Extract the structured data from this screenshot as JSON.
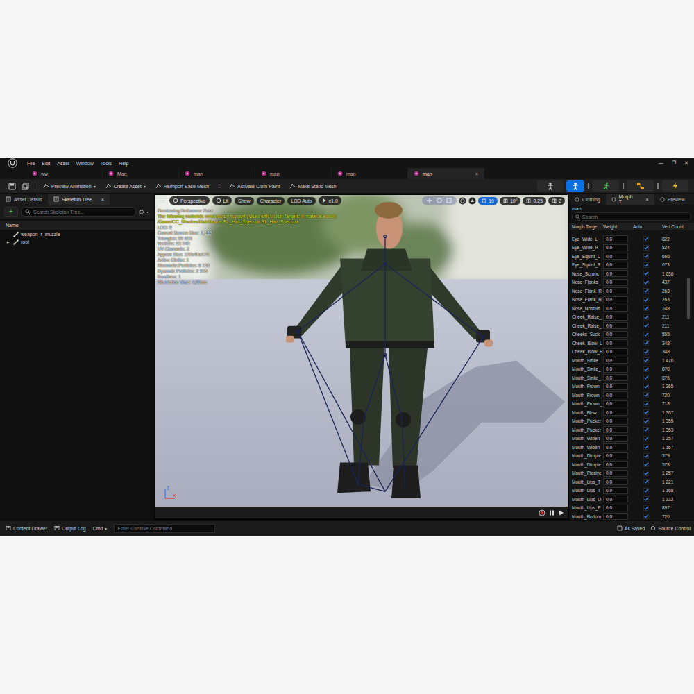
{
  "window": {
    "menu": [
      "File",
      "Edit",
      "Asset",
      "Window",
      "Tools",
      "Help"
    ],
    "controls": [
      "—",
      "❐",
      "✕"
    ]
  },
  "document_tabs": [
    {
      "label": "ww",
      "selected": false
    },
    {
      "label": "Man",
      "selected": false
    },
    {
      "label": "man",
      "selected": false
    },
    {
      "label": "man",
      "selected": false
    },
    {
      "label": "man",
      "selected": false
    },
    {
      "label": "man",
      "selected": true
    }
  ],
  "tab_close": "×",
  "toolbar": {
    "caret": "▾",
    "items": [
      {
        "label": "Preview Animation",
        "kind": "dropdown"
      },
      {
        "label": "Create Asset",
        "kind": "dropdown"
      },
      {
        "label": "Reimport Base Mesh",
        "kind": "button"
      },
      {
        "label": "⋮",
        "kind": "more"
      },
      {
        "label": "Activate Cloth Paint",
        "kind": "button"
      },
      {
        "label": "Make Static Mesh",
        "kind": "button"
      }
    ],
    "modes": [
      {
        "selected": false,
        "more": false
      },
      {
        "selected": true,
        "more": true
      },
      {
        "selected": false,
        "more": true
      },
      {
        "selected": false,
        "more": true
      },
      {
        "selected": false,
        "more": false
      }
    ]
  },
  "skeleton_panel": {
    "tabs": [
      {
        "label": "Asset Details",
        "selected": false,
        "closable": false
      },
      {
        "label": "Skeleton Tree",
        "selected": true,
        "closable": true
      }
    ],
    "add": "+",
    "search_placeholder": "Search Skeleton Tree...",
    "column": "Name",
    "expander": "▸",
    "bones": [
      {
        "label": "weapon_r_muzzle",
        "expandable": false
      },
      {
        "label": "root",
        "expandable": true
      }
    ]
  },
  "viewport": {
    "buttons": [
      {
        "label": "Perspective",
        "kind": "icon"
      },
      {
        "label": "Lit",
        "kind": "icon"
      },
      {
        "label": "Show",
        "kind": "text"
      },
      {
        "label": "Character",
        "kind": "text"
      },
      {
        "label": "LOD Auto",
        "kind": "text"
      },
      {
        "label": "x1.0",
        "kind": "play"
      }
    ],
    "snaps": [
      {
        "label": "10",
        "selected": true
      },
      {
        "label": "10°",
        "selected": false
      },
      {
        "label": "0,25",
        "selected": false
      },
      {
        "label": "2",
        "selected": false
      }
    ],
    "info": [
      {
        "text": "Previewing Reference Pose",
        "kind": "heading"
      },
      {
        "text": "The following materials need morph support ('Used with Morph Targets' in material editor):",
        "kind": "warning"
      },
      {
        "text": "/Game/CC_Shaders/HairShader/RL_Hair_Specular.RL_Hair_Specular",
        "kind": "warning"
      },
      {
        "text": "LOD: 0",
        "kind": "stat"
      },
      {
        "text": "Current Screen Size: 1,189",
        "kind": "stat"
      },
      {
        "text": "Triangles: 88 603",
        "kind": "stat"
      },
      {
        "text": "Vertices: 63 545",
        "kind": "stat"
      },
      {
        "text": "UV Channels: 2",
        "kind": "stat"
      },
      {
        "text": "Approx Size: 135x45x178",
        "kind": "stat"
      },
      {
        "text": "Active Cloths: 1",
        "kind": "stat"
      },
      {
        "text": "Kinematic Particles: 9 755",
        "kind": "stat"
      },
      {
        "text": "Dynamic Particles: 2 975",
        "kind": "stat"
      },
      {
        "text": "Iterations: 1",
        "kind": "stat"
      },
      {
        "text": "Simulation Time: 4,98ms",
        "kind": "stat"
      }
    ]
  },
  "morph_panel": {
    "tabs": [
      {
        "label": "Clothing",
        "selected": false,
        "closable": false
      },
      {
        "label": "Morph T",
        "selected": true,
        "closable": true
      },
      {
        "label": "Preview...",
        "selected": false,
        "closable": false
      }
    ],
    "mesh": "man",
    "search_placeholder": "Search",
    "columns": [
      "Morph Targe",
      "Weight",
      "Auto",
      "Vert Count"
    ],
    "rows": [
      {
        "name": "Eye_Wide_L",
        "weight": "0,0",
        "auto": true,
        "verts": "822"
      },
      {
        "name": "Eye_Wide_R",
        "weight": "0,0",
        "auto": true,
        "verts": "824"
      },
      {
        "name": "Eye_Squint_L",
        "weight": "0,0",
        "auto": true,
        "verts": "666"
      },
      {
        "name": "Eye_Squint_R",
        "weight": "0,0",
        "auto": true,
        "verts": "673"
      },
      {
        "name": "Nose_Scrunc",
        "weight": "0,0",
        "auto": true,
        "verts": "1 636"
      },
      {
        "name": "Nose_Flanks_",
        "weight": "0,0",
        "auto": true,
        "verts": "437"
      },
      {
        "name": "Nose_Flank_R",
        "weight": "0,0",
        "auto": true,
        "verts": "263"
      },
      {
        "name": "Nose_Flank_R",
        "weight": "0,0",
        "auto": true,
        "verts": "263"
      },
      {
        "name": "Nose_Nostrils",
        "weight": "0,0",
        "auto": true,
        "verts": "248"
      },
      {
        "name": "Cheek_Raise_",
        "weight": "0,0",
        "auto": true,
        "verts": "211"
      },
      {
        "name": "Cheek_Raise_",
        "weight": "0,0",
        "auto": true,
        "verts": "211"
      },
      {
        "name": "Cheeks_Suck",
        "weight": "0,0",
        "auto": true,
        "verts": "555"
      },
      {
        "name": "Cheek_Blow_L",
        "weight": "0,0",
        "auto": true,
        "verts": "348"
      },
      {
        "name": "Cheek_Blow_R",
        "weight": "0,0",
        "auto": true,
        "verts": "348"
      },
      {
        "name": "Mouth_Smile",
        "weight": "0,0",
        "auto": true,
        "verts": "1 476"
      },
      {
        "name": "Mouth_Smile_",
        "weight": "0,0",
        "auto": true,
        "verts": "878"
      },
      {
        "name": "Mouth_Smile_",
        "weight": "0,0",
        "auto": true,
        "verts": "876"
      },
      {
        "name": "Mouth_Frown",
        "weight": "0,0",
        "auto": true,
        "verts": "1 365"
      },
      {
        "name": "Mouth_Frown_",
        "weight": "0,0",
        "auto": true,
        "verts": "720"
      },
      {
        "name": "Mouth_Frown_",
        "weight": "0,0",
        "auto": true,
        "verts": "718"
      },
      {
        "name": "Mouth_Blow",
        "weight": "0,0",
        "auto": true,
        "verts": "1 307"
      },
      {
        "name": "Mouth_Pucker",
        "weight": "0,0",
        "auto": true,
        "verts": "1 355"
      },
      {
        "name": "Mouth_Pucker",
        "weight": "0,0",
        "auto": true,
        "verts": "1 353"
      },
      {
        "name": "Mouth_Widen",
        "weight": "0,0",
        "auto": true,
        "verts": "1 257"
      },
      {
        "name": "Mouth_Widen_",
        "weight": "0,0",
        "auto": true,
        "verts": "1 167"
      },
      {
        "name": "Mouth_Dimple",
        "weight": "0,0",
        "auto": true,
        "verts": "579"
      },
      {
        "name": "Mouth_Dimple",
        "weight": "0,0",
        "auto": true,
        "verts": "578"
      },
      {
        "name": "Mouth_Plosive",
        "weight": "0,0",
        "auto": true,
        "verts": "1 257"
      },
      {
        "name": "Mouth_Lips_T",
        "weight": "0,0",
        "auto": true,
        "verts": "1 221"
      },
      {
        "name": "Mouth_Lips_T",
        "weight": "0,0",
        "auto": true,
        "verts": "1 168"
      },
      {
        "name": "Mouth_Lips_O",
        "weight": "0,0",
        "auto": true,
        "verts": "1 332"
      },
      {
        "name": "Mouth_Lips_P",
        "weight": "0,0",
        "auto": true,
        "verts": "897"
      },
      {
        "name": "Mouth_Bottom",
        "weight": "0,0",
        "auto": true,
        "verts": "720"
      }
    ]
  },
  "status_bar": {
    "items": [
      {
        "label": "Content Drawer",
        "kind": "drawer"
      },
      {
        "label": "Output Log",
        "kind": "log"
      },
      {
        "label": "Cmd",
        "kind": "cmd"
      }
    ],
    "console_placeholder": "Enter Console Command",
    "right": [
      {
        "label": "All Saved",
        "kind": "saved"
      },
      {
        "label": "Source Control",
        "kind": "source"
      }
    ]
  }
}
